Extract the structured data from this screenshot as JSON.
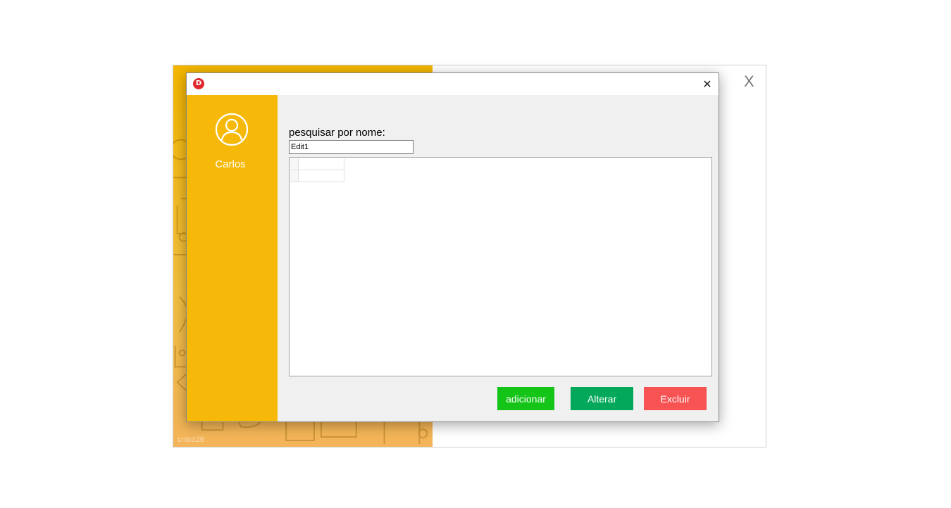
{
  "background_window": {
    "close_label": "X",
    "footer_text": "cnico26"
  },
  "dialog": {
    "app_icon_letter": "D",
    "close_glyph": "✕",
    "sidebar": {
      "user_name": "Carlos"
    },
    "search": {
      "label": "pesquisar por nome:",
      "value": "Edit1"
    },
    "buttons": {
      "add": "adicionar",
      "edit": "Alterar",
      "delete": "Excluir"
    }
  },
  "colors": {
    "sidebar": "#f6b90a",
    "add": "#14c417",
    "edit": "#03a85a",
    "delete": "#f75353"
  }
}
